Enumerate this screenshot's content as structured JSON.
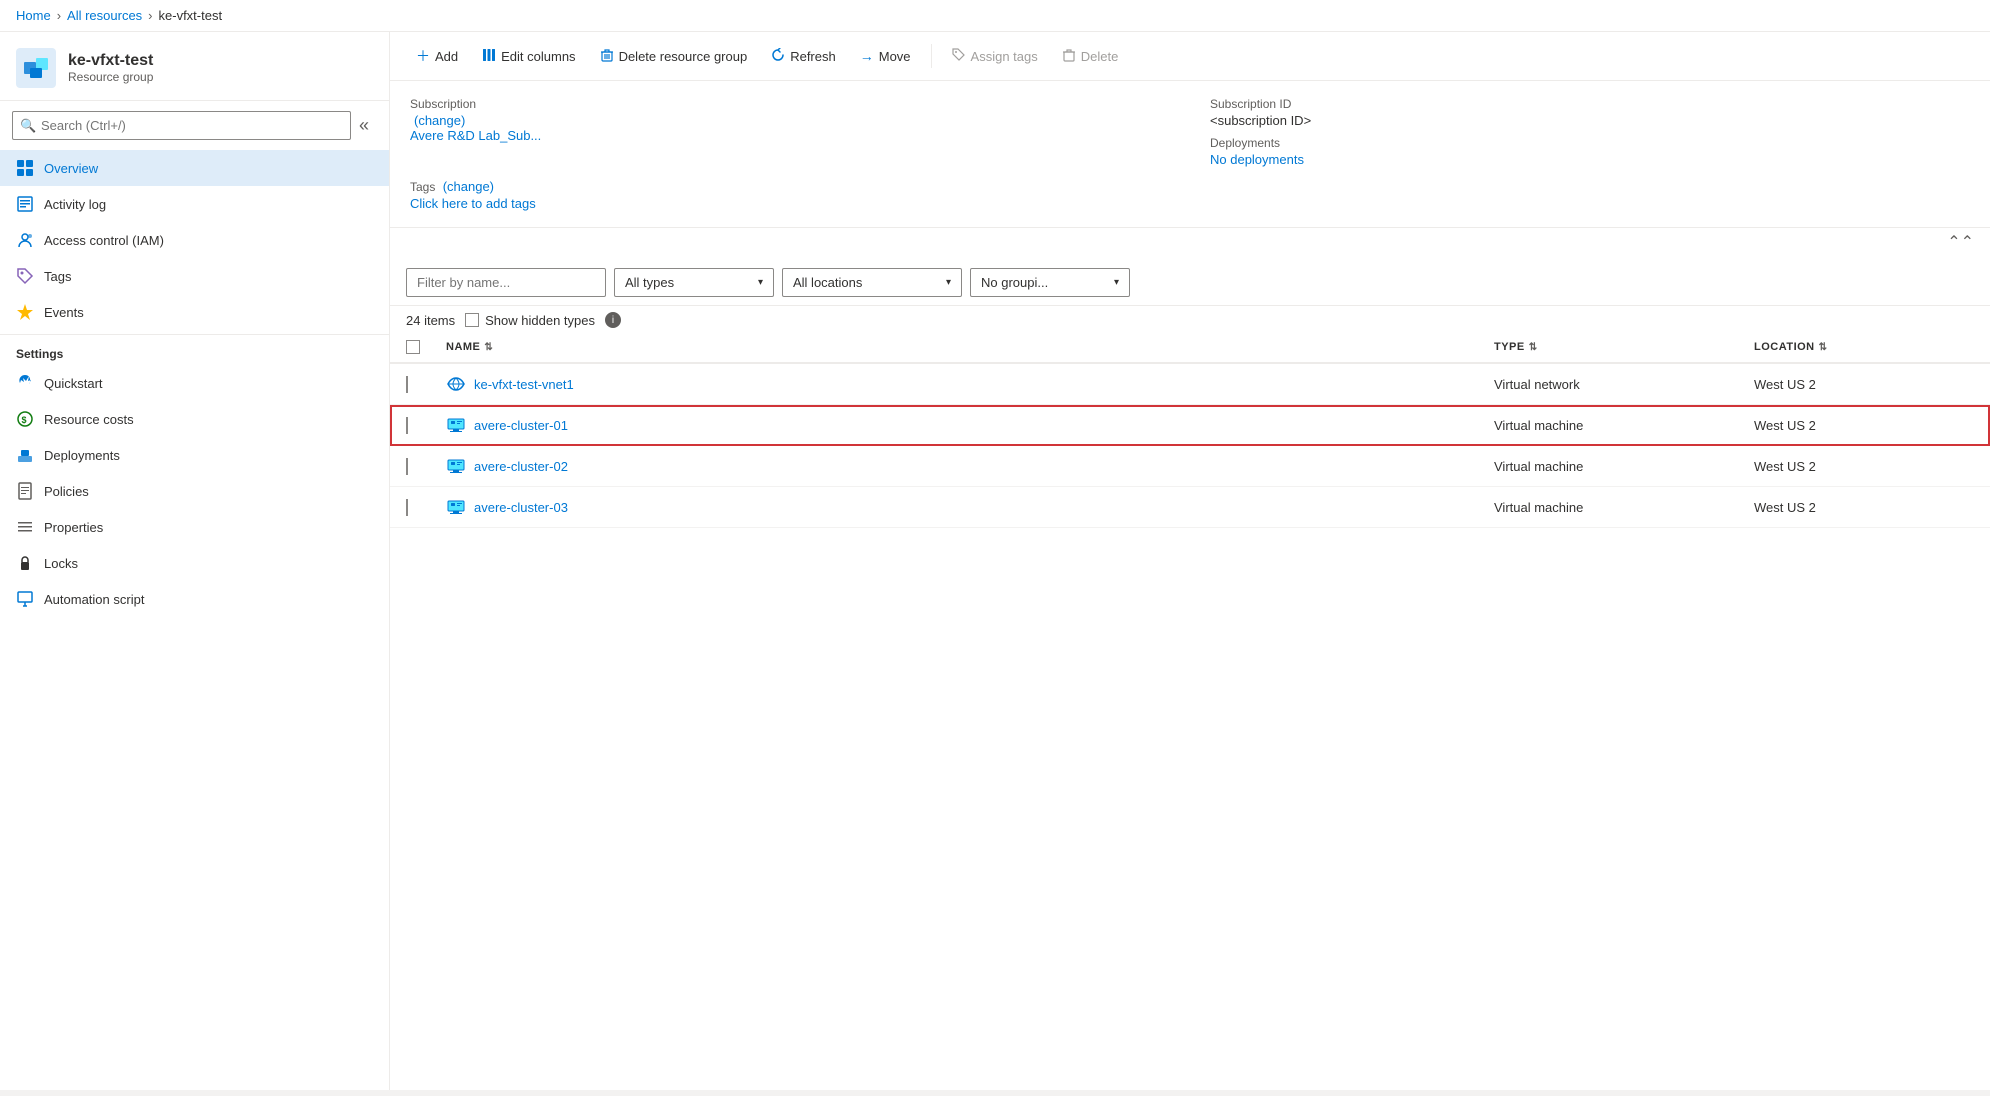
{
  "breadcrumb": {
    "home": "Home",
    "all_resources": "All resources",
    "current": "ke-vfxt-test"
  },
  "sidebar": {
    "resource_icon": "📦",
    "title": "ke-vfxt-test",
    "subtitle": "Resource group",
    "search_placeholder": "Search (Ctrl+/)",
    "nav_items": [
      {
        "id": "overview",
        "label": "Overview",
        "icon": "⬡",
        "active": true
      },
      {
        "id": "activity-log",
        "label": "Activity log",
        "icon": "📋"
      },
      {
        "id": "access-control",
        "label": "Access control (IAM)",
        "icon": "👥"
      },
      {
        "id": "tags",
        "label": "Tags",
        "icon": "🏷"
      },
      {
        "id": "events",
        "label": "Events",
        "icon": "⚡"
      }
    ],
    "settings_section": "Settings",
    "settings_items": [
      {
        "id": "quickstart",
        "label": "Quickstart",
        "icon": "☁"
      },
      {
        "id": "resource-costs",
        "label": "Resource costs",
        "icon": "💰"
      },
      {
        "id": "deployments",
        "label": "Deployments",
        "icon": "🔧"
      },
      {
        "id": "policies",
        "label": "Policies",
        "icon": "📄"
      },
      {
        "id": "properties",
        "label": "Properties",
        "icon": "☰"
      },
      {
        "id": "locks",
        "label": "Locks",
        "icon": "🔒"
      },
      {
        "id": "automation-script",
        "label": "Automation script",
        "icon": "⬇"
      }
    ]
  },
  "toolbar": {
    "add_label": "Add",
    "edit_columns_label": "Edit columns",
    "delete_rg_label": "Delete resource group",
    "refresh_label": "Refresh",
    "move_label": "Move",
    "assign_tags_label": "Assign tags",
    "delete_label": "Delete"
  },
  "info": {
    "subscription_label": "Subscription",
    "subscription_change": "(change)",
    "subscription_value": "Avere R&D Lab_Sub...",
    "subscription_id_label": "Subscription ID",
    "subscription_id_value": "<subscription ID>",
    "deployments_label": "Deployments",
    "deployments_value": "No deployments",
    "tags_label": "Tags",
    "tags_change": "(change)",
    "tags_add": "Click here to add tags"
  },
  "filters": {
    "name_placeholder": "Filter by name...",
    "type_label": "All types",
    "location_label": "All locations",
    "grouping_label": "No groupi...",
    "items_count": "24 items",
    "show_hidden_label": "Show hidden types"
  },
  "table": {
    "col_name": "NAME",
    "col_type": "TYPE",
    "col_location": "LOCATION",
    "rows": [
      {
        "id": "vnet1",
        "name": "ke-vfxt-test-vnet1",
        "type": "Virtual network",
        "location": "West US 2",
        "highlighted": false,
        "icon_type": "vnet"
      },
      {
        "id": "cluster01",
        "name": "avere-cluster-01",
        "type": "Virtual machine",
        "location": "West US 2",
        "highlighted": true,
        "icon_type": "vm"
      },
      {
        "id": "cluster02",
        "name": "avere-cluster-02",
        "type": "Virtual machine",
        "location": "West US 2",
        "highlighted": false,
        "icon_type": "vm"
      },
      {
        "id": "cluster03",
        "name": "avere-cluster-03",
        "type": "Virtual machine",
        "location": "West US 2",
        "highlighted": false,
        "icon_type": "vm"
      }
    ]
  }
}
